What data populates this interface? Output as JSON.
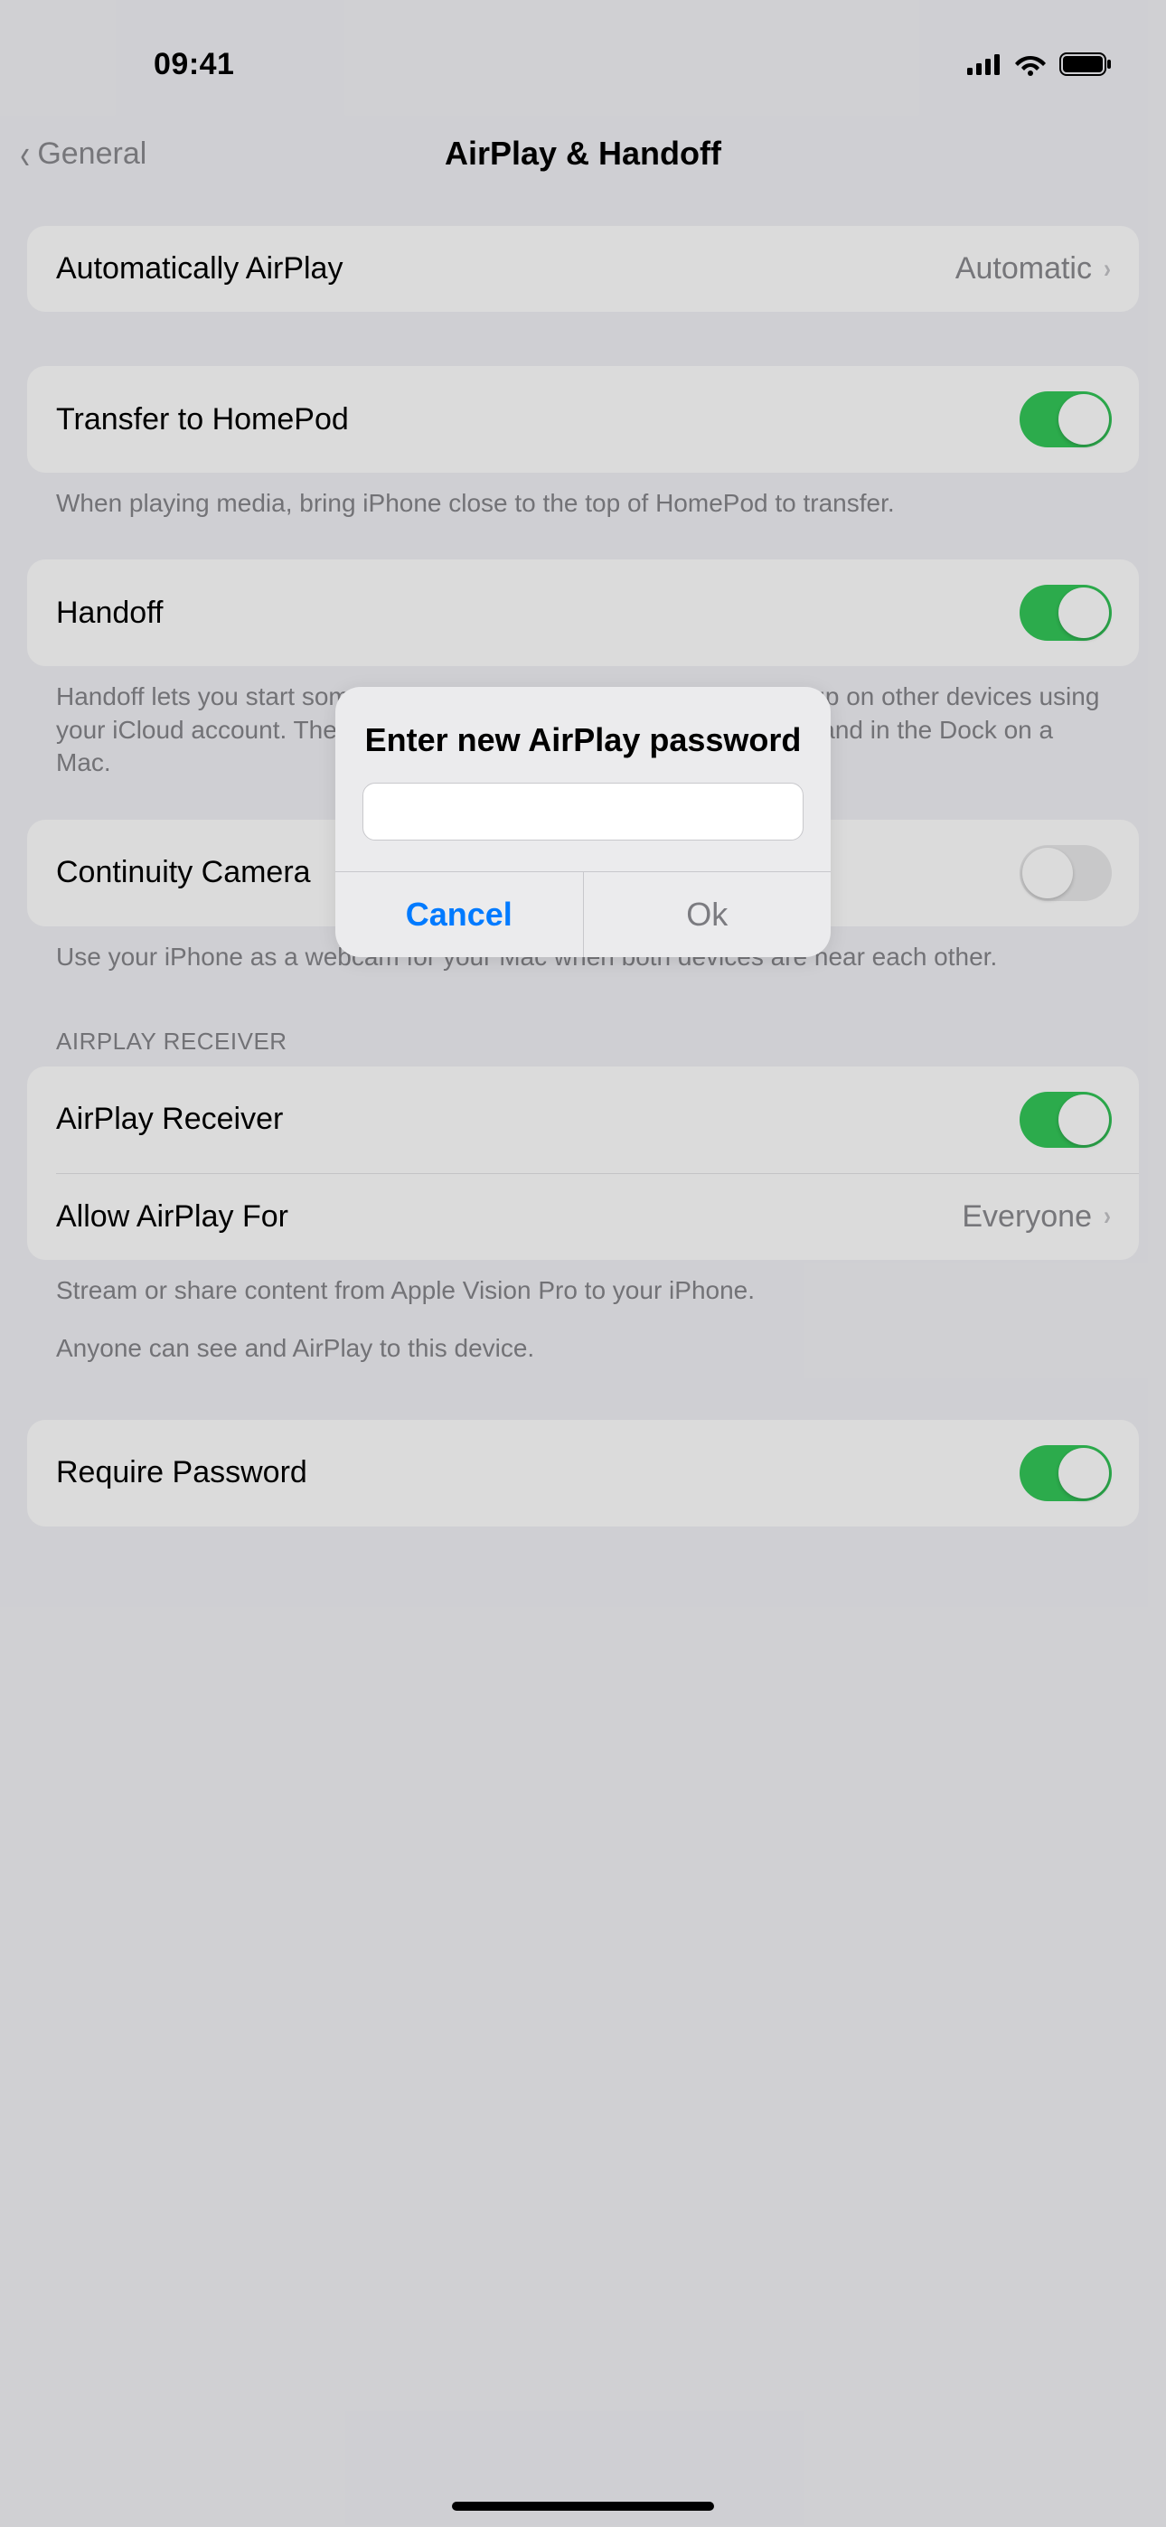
{
  "statusBar": {
    "time": "09:41"
  },
  "nav": {
    "back": "General",
    "title": "AirPlay & Handoff"
  },
  "rows": {
    "autoAirplay": {
      "label": "Automatically AirPlay",
      "value": "Automatic"
    },
    "transferHomepod": {
      "label": "Transfer to HomePod",
      "on": true
    },
    "transferHomepodFooter": "When playing media, bring iPhone close to the top of HomePod to transfer.",
    "handoff": {
      "label": "Handoff",
      "on": true
    },
    "handoffFooter": "Handoff lets you start something on one device and instantly pick it up on other devices using your iCloud account. The app you need appears in the app switcher and in the Dock on a Mac.",
    "continuityCamera": {
      "label": "Continuity Camera",
      "on": false
    },
    "continuityCameraFooter": "Use your iPhone as a webcam for your Mac when both devices are near each other.",
    "airplayReceiverHeader": "AIRPLAY RECEIVER",
    "airplayReceiver": {
      "label": "AirPlay Receiver",
      "on": true
    },
    "allowAirplayFor": {
      "label": "Allow AirPlay For",
      "value": "Everyone"
    },
    "airplayReceiverFooter1": "Stream or share content from Apple Vision Pro to your iPhone.",
    "airplayReceiverFooter2": "Anyone can see and AirPlay to this device.",
    "requirePassword": {
      "label": "Require Password",
      "on": true
    }
  },
  "alert": {
    "title": "Enter new AirPlay password",
    "cancel": "Cancel",
    "ok": "Ok"
  }
}
